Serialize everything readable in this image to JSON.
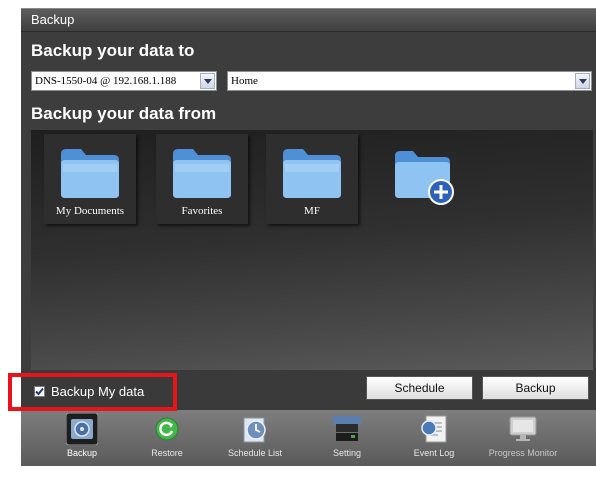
{
  "window": {
    "title": "Backup"
  },
  "destination": {
    "heading": "Backup your data to",
    "device": "DNS-1550-04 @ 192.168.1.188",
    "folder": "Home"
  },
  "source": {
    "heading": "Backup your data from",
    "folders": [
      {
        "label": "My Documents"
      },
      {
        "label": "Favorites"
      },
      {
        "label": "MF"
      }
    ],
    "add_icon": "folder-add-icon"
  },
  "options": {
    "backup_my_data_label": "Backup My data",
    "backup_my_data_checked": true
  },
  "buttons": {
    "schedule": "Schedule",
    "backup": "Backup"
  },
  "dock": {
    "items": [
      {
        "label": "Backup",
        "icon": "backup-icon",
        "active": true
      },
      {
        "label": "Restore",
        "icon": "restore-icon"
      },
      {
        "label": "Schedule List",
        "icon": "schedule-list-icon"
      },
      {
        "label": "Setting",
        "icon": "setting-icon"
      },
      {
        "label": "Event Log",
        "icon": "event-log-icon"
      },
      {
        "label": "Progress Monitor",
        "icon": "progress-monitor-icon",
        "disabled": true
      }
    ]
  },
  "colors": {
    "highlight": "#e8141b",
    "panel_bg": "#3d3d3d"
  }
}
